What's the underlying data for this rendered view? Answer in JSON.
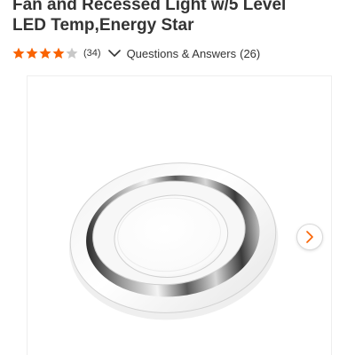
{
  "product": {
    "title_lines": [
      "Fan and Recessed Light w/5 Level",
      "LED Temp,Energy Star"
    ]
  },
  "rating": {
    "stars": 4,
    "max_stars": 5,
    "review_count": "(34)",
    "star_color": "#f96302",
    "empty_star_color": "#c8c8c8"
  },
  "qa": {
    "label": "Questions & Answers",
    "count": "(26)",
    "icon": "chevron-down-icon"
  },
  "carousel": {
    "next_icon": "chevron-right-icon",
    "accent_color": "#f96302"
  }
}
